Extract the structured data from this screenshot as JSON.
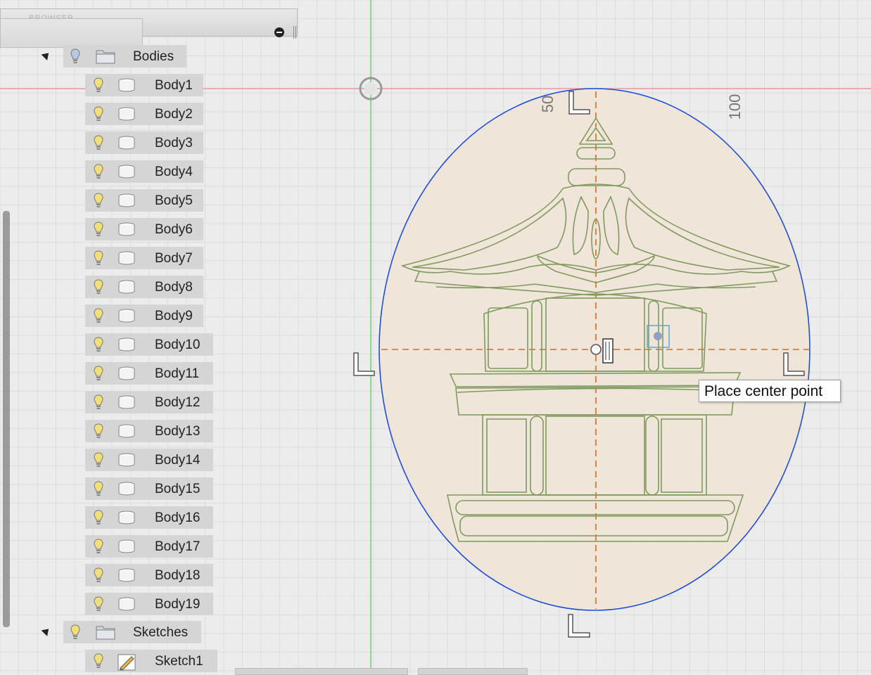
{
  "browser": {
    "header_title": "BROWSER",
    "bodies_folder": {
      "label": "Bodies",
      "icon": "lightbulb-icon"
    },
    "bodies": [
      "Body1",
      "Body2",
      "Body3",
      "Body4",
      "Body5",
      "Body6",
      "Body7",
      "Body8",
      "Body9",
      "Body10",
      "Body11",
      "Body12",
      "Body13",
      "Body14",
      "Body15",
      "Body16",
      "Body17",
      "Body18",
      "Body19"
    ],
    "sketches_folder": {
      "label": "Sketches"
    },
    "sketches": [
      "Sketch1"
    ]
  },
  "canvas": {
    "axis_label_50": "50",
    "axis_label_100": "100",
    "tooltip": "Place center point"
  },
  "colors": {
    "x_axis": "#e79a9a",
    "y_axis": "#6fcf6f",
    "ellipse": "#1f4fd8",
    "fill": "#f1e4d6",
    "sketch_lines": "#7f9a5e",
    "center_lines": "#d96a1e",
    "grid": "#d8d8d8",
    "bulb": "#f3df7a"
  }
}
